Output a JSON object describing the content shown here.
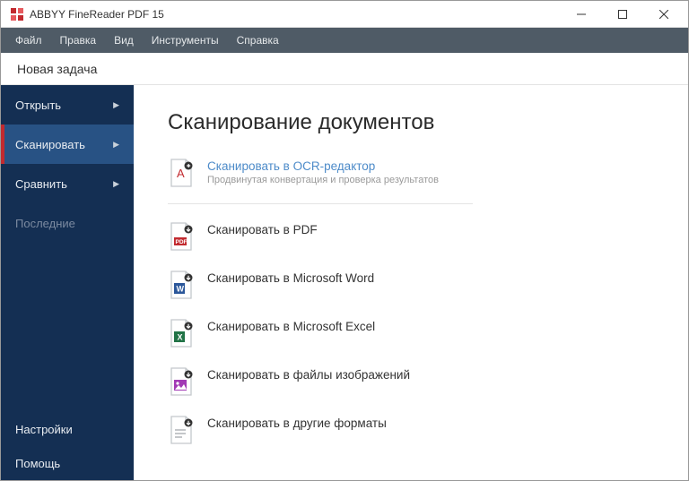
{
  "titlebar": {
    "title": "ABBYY FineReader PDF 15"
  },
  "menubar": {
    "items": [
      {
        "label": "Файл"
      },
      {
        "label": "Правка"
      },
      {
        "label": "Вид"
      },
      {
        "label": "Инструменты"
      },
      {
        "label": "Справка"
      }
    ]
  },
  "newtask": {
    "label": "Новая задача"
  },
  "sidebar": {
    "items": [
      {
        "label": "Открыть"
      },
      {
        "label": "Сканировать"
      },
      {
        "label": "Сравнить"
      },
      {
        "label": "Последние"
      }
    ],
    "footer": [
      {
        "label": "Настройки"
      },
      {
        "label": "Помощь"
      }
    ]
  },
  "main": {
    "heading": "Сканирование документов",
    "featured": {
      "title": "Сканировать в OCR-редактор",
      "subtitle": "Продвинутая конвертация и проверка результатов"
    },
    "tasks": [
      {
        "title": "Сканировать в PDF"
      },
      {
        "title": "Сканировать в Microsoft Word"
      },
      {
        "title": "Сканировать в Microsoft Excel"
      },
      {
        "title": "Сканировать в файлы изображений"
      },
      {
        "title": "Сканировать в другие форматы"
      }
    ]
  },
  "colors": {
    "accent_red": "#c22a2f",
    "sidebar_bg": "#142f53",
    "sidebar_sel": "#285284",
    "link": "#4d8bc9"
  }
}
